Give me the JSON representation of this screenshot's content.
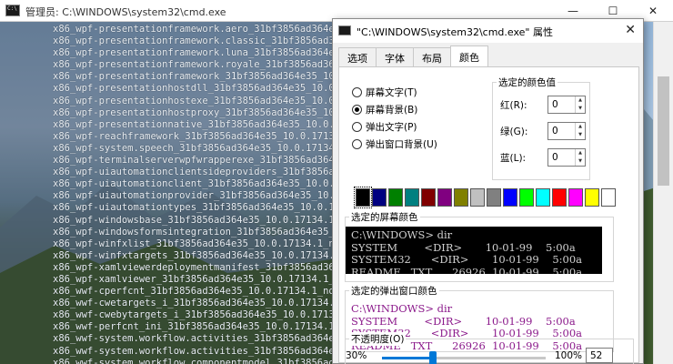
{
  "cmd_window": {
    "title": "管理员: C:\\WINDOWS\\system32\\cmd.exe",
    "lines": [
      "x86_wpf-presentationframework.aero_31bf3856ad364e35",
      "x86_wpf-presentationframework.classic_31bf3856ad364e",
      "x86_wpf-presentationframework.luna_31bf3856ad364e35",
      "x86_wpf-presentationframework.royale_31bf3856ad364e35",
      "x86_wpf-presentationframework_31bf3856ad364e35_10.0.",
      "x86_wpf-presentationhostdll_31bf3856ad364e35_10.0.171",
      "x86_wpf-presentationhostexe_31bf3856ad364e35_10.0.171",
      "x86_wpf-presentationhostproxy_31bf3856ad364e35_10.0.1",
      "x86_wpf-presentationnative_31bf3856ad364e35_10.0.1713",
      "x86_wpf-reachframework_31bf3856ad364e35_10.0.17134.1",
      "x86_wpf-system.speech_31bf3856ad364e35_10.0.17134.1_",
      "x86_wpf-terminalserverwpfwrapperexe_31bf3856ad364e35_",
      "x86_wpf-uiautomationclientsideproviders_31bf3856ad364",
      "x86_wpf-uiautomationclient_31bf3856ad364e35_10.0.1713",
      "x86_wpf-uiautomationprovider_31bf3856ad364e35_10.0.17",
      "x86_wpf-uiautomationtypes_31bf3856ad364e35_10.0.17134",
      "x86_wpf-windowsbase_31bf3856ad364e35_10.0.17134.1_non",
      "x86_wpf-windowsformsintegration_31bf3856ad364e35_10.0",
      "x86_wpf-winfxlist_31bf3856ad364e35_10.0.17134.1_none_",
      "x86_wpf-winfxtargets_31bf3856ad364e35_10.0.17134.1_no",
      "x86_wpf-xamlviewerdeploymentmanifest_31bf3856ad364e35",
      "x86_wpf-xamlviewer_31bf3856ad364e35_10.0.17134.1_none",
      "x86_wwf-cperfcnt_31bf3856ad364e35_10.0.17134.1_none_",
      "x86_wwf-cwetargets_i_31bf3856ad364e35_10.0.17134.1_no",
      "x86_wwf-cwebytargets_i_31bf3856ad364e35_10.0.17134.1_",
      "x86_wwf-perfcnt_ini_31bf3856ad364e35_10.0.17134.1_non",
      "x86_wwf-system.workflow.activities_31bf3856ad364e35_1",
      "x86_wwf-system.workflow.activities_31bf3856ad364e35_1",
      "x86_wwf-system.workflow.componentmodel_31bf3856ad364e",
      "x86_wwf-system.workflow.runtime_31bf3856ad364e35_10.0"
    ]
  },
  "dialog": {
    "title": "\"C:\\WINDOWS\\system32\\cmd.exe\" 属性",
    "tabs": [
      "选项",
      "字体",
      "布局",
      "颜色"
    ],
    "radios": [
      {
        "label": "屏幕文字(T)",
        "selected": false
      },
      {
        "label": "屏幕背景(B)",
        "selected": true
      },
      {
        "label": "弹出文字(P)",
        "selected": false
      },
      {
        "label": "弹出窗口背景(U)",
        "selected": false
      }
    ],
    "selected_color": {
      "legend": "选定的颜色值",
      "red_label": "红(R):",
      "red_value": "0",
      "green_label": "绿(G):",
      "green_value": "0",
      "blue_label": "蓝(L):",
      "blue_value": "0"
    },
    "palette": [
      "#000000",
      "#000080",
      "#008000",
      "#008080",
      "#800000",
      "#800080",
      "#808000",
      "#c0c0c0",
      "#808080",
      "#0000ff",
      "#00ff00",
      "#00ffff",
      "#ff0000",
      "#ff00ff",
      "#ffff00",
      "#ffffff"
    ],
    "screen_preview": {
      "legend": "选定的屏幕颜色",
      "line1": "C:\\WINDOWS> dir",
      "line2": "SYSTEM        <DIR>       10-01-99    5:00a",
      "line3": "SYSTEM32      <DIR>       10-01-99    5:00a",
      "line4": "README   TXT      26926  10-01-99    5:00a"
    },
    "popup_preview": {
      "legend": "选定的弹出窗口颜色",
      "line1": "C:\\WINDOWS> dir",
      "line2": "SYSTEM        <DIR>       10-01-99    5:00a",
      "line3": "SYSTEM32      <DIR>       10-01-99    5:00a",
      "line4": "README   TXT      26926  10-01-99    5:00a"
    },
    "opacity": {
      "legend": "不透明度(O)",
      "min_label": "30%",
      "max_label": "100%",
      "value": "52",
      "fraction": 0.31
    }
  }
}
